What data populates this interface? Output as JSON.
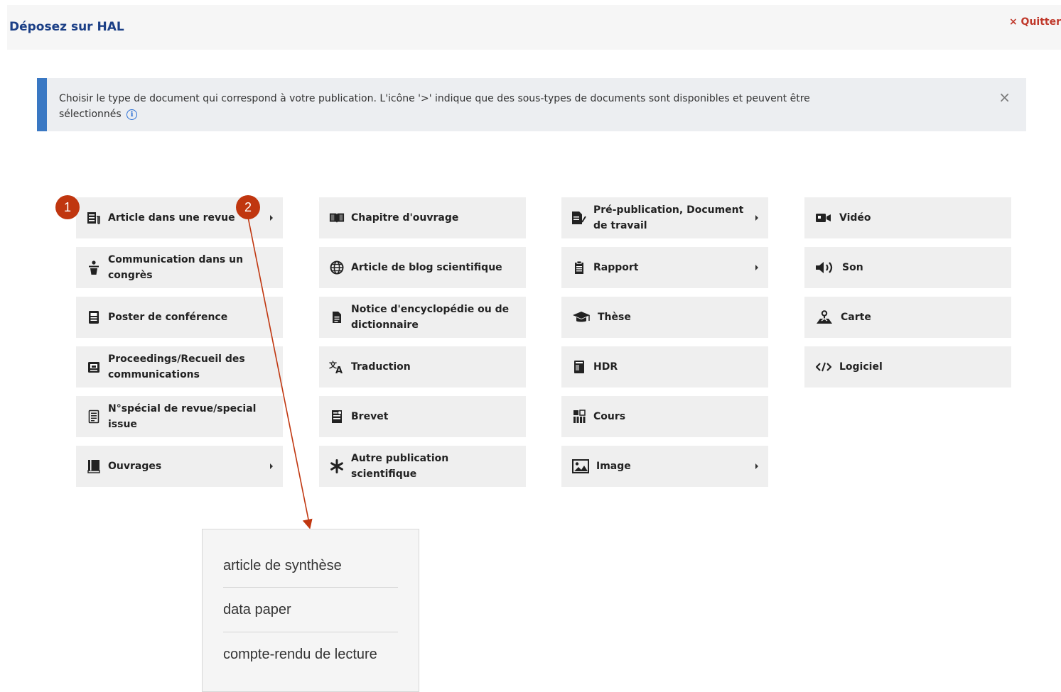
{
  "header": {
    "title": "Déposez sur HAL",
    "quit_label": "× Quitter"
  },
  "banner": {
    "message": "Choisir le type de document qui correspond à votre publication. L'icône '>' indique que des sous-types de documents sont disponibles et peuvent être sélectionnés",
    "info_icon": "i",
    "close_label": "×"
  },
  "columns": [
    [
      {
        "label": "Article dans une revue",
        "icon": "newspaper-icon",
        "submenu": true
      },
      {
        "label": "Communication dans un congrès",
        "icon": "podium-icon",
        "submenu": false
      },
      {
        "label": "Poster de conférence",
        "icon": "poster-icon",
        "submenu": false
      },
      {
        "label": "Proceedings/Recueil des communications",
        "icon": "proceedings-icon",
        "submenu": false
      },
      {
        "label": "N°spécial de revue/special issue",
        "icon": "special-issue-icon",
        "submenu": false
      },
      {
        "label": "Ouvrages",
        "icon": "book-icon",
        "submenu": true
      }
    ],
    [
      {
        "label": "Chapitre d'ouvrage",
        "icon": "open-book-icon",
        "submenu": false
      },
      {
        "label": "Article de blog scientifique",
        "icon": "globe-icon",
        "submenu": false
      },
      {
        "label": "Notice d'encyclopédie ou de dictionnaire",
        "icon": "document-icon",
        "submenu": false
      },
      {
        "label": "Traduction",
        "icon": "translate-icon",
        "submenu": false
      },
      {
        "label": "Brevet",
        "icon": "patent-icon",
        "submenu": false
      },
      {
        "label": "Autre publication scientifique",
        "icon": "asterisk-icon",
        "submenu": false
      }
    ],
    [
      {
        "label": "Pré-publication, Document de travail",
        "icon": "edit-document-icon",
        "submenu": true
      },
      {
        "label": "Rapport",
        "icon": "clipboard-icon",
        "submenu": true
      },
      {
        "label": "Thèse",
        "icon": "graduation-cap-icon",
        "submenu": false
      },
      {
        "label": "HDR",
        "icon": "hdr-icon",
        "submenu": false
      },
      {
        "label": "Cours",
        "icon": "course-icon",
        "submenu": false
      },
      {
        "label": "Image",
        "icon": "image-icon",
        "submenu": true
      }
    ],
    [
      {
        "label": "Vidéo",
        "icon": "video-icon",
        "submenu": false
      },
      {
        "label": "Son",
        "icon": "speaker-icon",
        "submenu": false
      },
      {
        "label": "Carte",
        "icon": "map-person-icon",
        "submenu": false
      },
      {
        "label": "Logiciel",
        "icon": "code-icon",
        "submenu": false
      }
    ]
  ],
  "badges": [
    "1",
    "2"
  ],
  "dropdown": {
    "items": [
      "article de synthèse",
      "data paper",
      "compte-rendu de lecture"
    ]
  },
  "colors": {
    "header_title": "#1b3f86",
    "quit": "#c0392b",
    "banner_accent": "#3a78c3",
    "badge": "#c0360f",
    "arrow": "#c0360f"
  }
}
